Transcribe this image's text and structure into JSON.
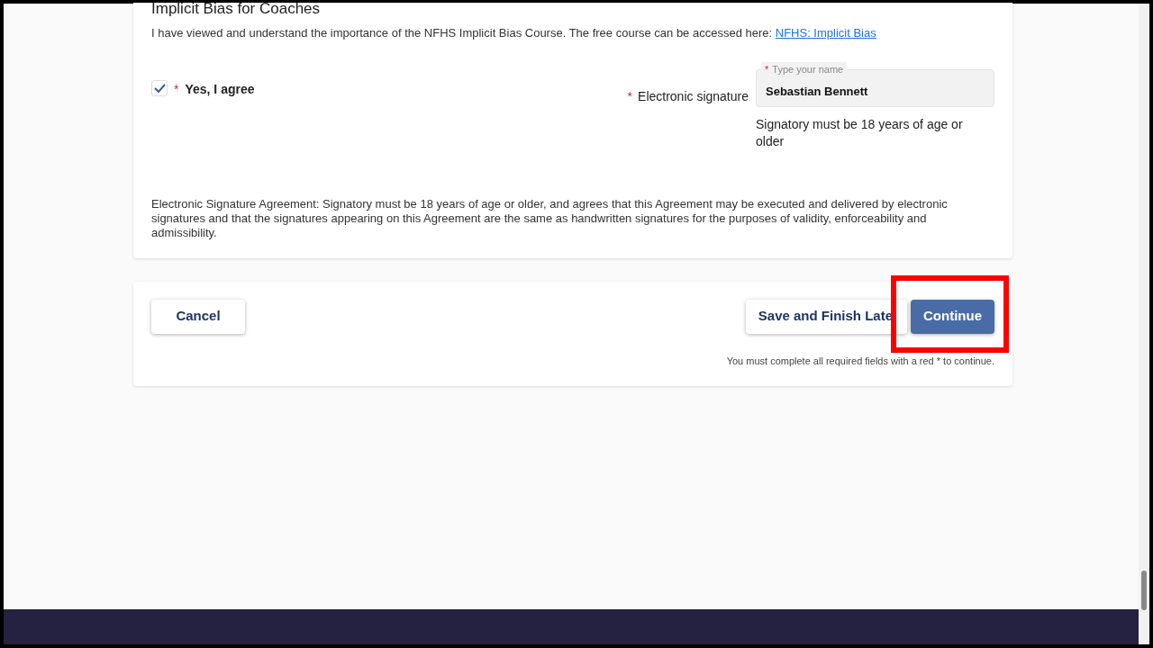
{
  "section": {
    "title": "Implicit Bias for Coaches",
    "description": "I have viewed and understand the importance of the NFHS Implicit Bias Course. The free course can be accessed here: ",
    "link": "NFHS: Implicit Bias",
    "agree": {
      "label": "Yes, I agree",
      "required_mark": "*",
      "checked": true
    },
    "signature": {
      "label": "Electronic signature",
      "required_mark": "*",
      "floating_label_mark": "*",
      "floating_label": "Type your name",
      "value": "Sebastian Bennett",
      "help": "Signatory must be 18 years of age or older"
    },
    "agreement_text": "Electronic Signature Agreement: Signatory must be 18 years of age or older, and agrees that this Agreement may be executed and delivered by electronic signatures and that the signatures appearing on this Agreement are the same as handwritten signatures for the purposes of validity, enforceability and admissibility."
  },
  "actions": {
    "cancel": "Cancel",
    "save": "Save and Finish Late",
    "continue": "Continue",
    "note": "You must complete all required fields with a red * to continue."
  }
}
